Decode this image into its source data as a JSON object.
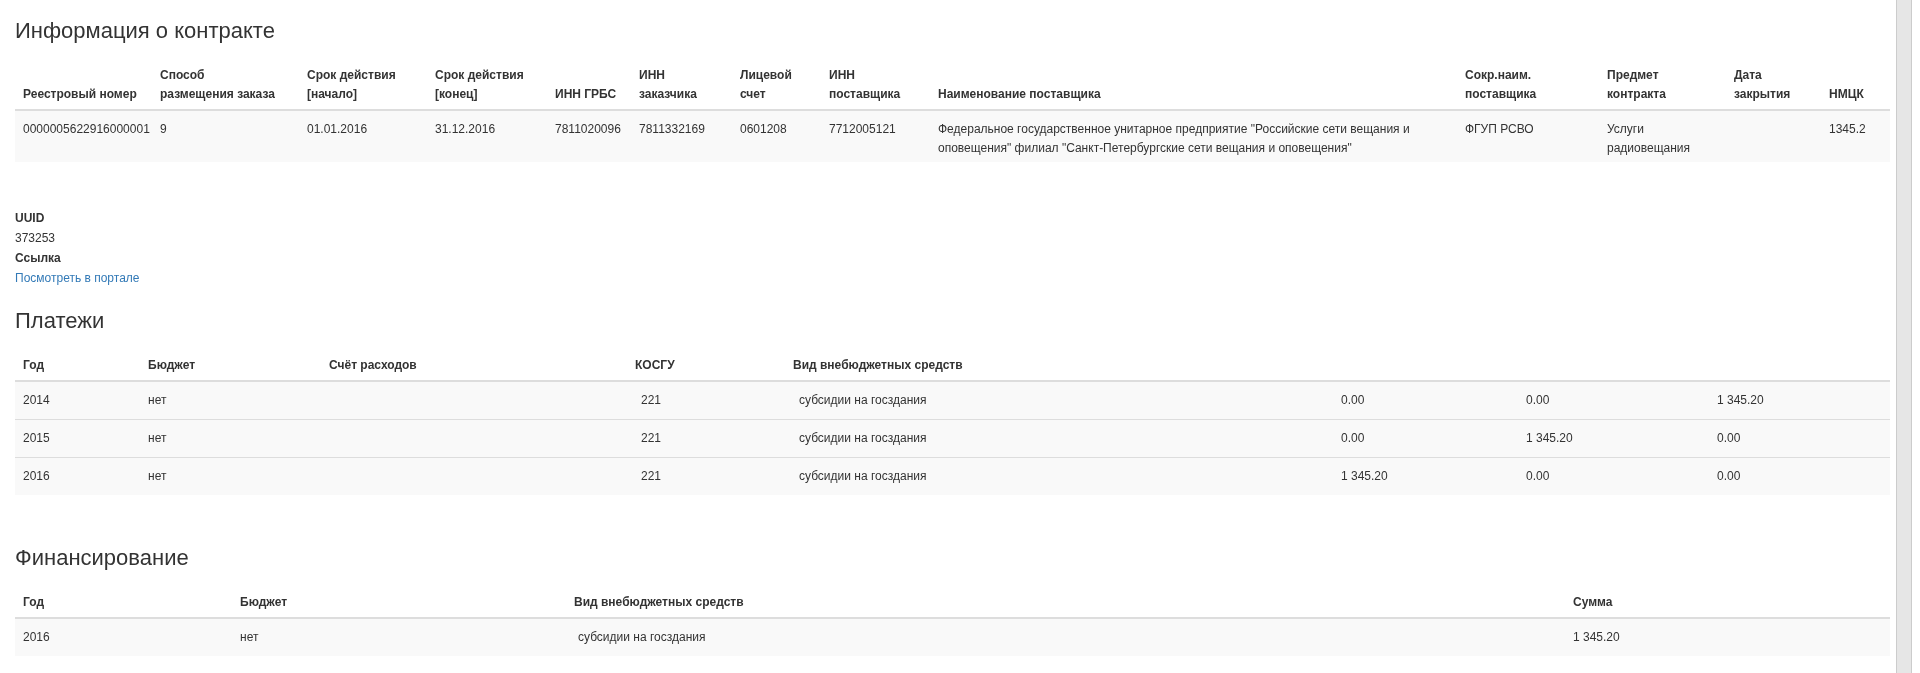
{
  "contract": {
    "title": "Информация о контракте",
    "columns": [
      "Реестровый номер",
      "Способ\nразмещения заказа",
      "Срок действия\n[начало]",
      "Срок действия\n[конец]",
      "ИНН ГРБС",
      "ИНН\nзаказчика",
      "Лицевой\nсчет",
      "ИНН\nпоставщика",
      "Наименование поставщика",
      "Сокр.наим.\nпоставщика",
      "Предмет\nконтракта",
      "Дата\nзакрытия",
      "НМЦК"
    ],
    "rows": [
      {
        "cells": [
          "0000005622916000001",
          "9",
          "01.01.2016",
          "31.12.2016",
          "7811020096",
          "7811332169",
          "0601208",
          "7712005121",
          "Федеральное государственное унитарное предприятие \"Российские сети вещания и оповещения\" филиал \"Санкт-Петербургские сети вещания и оповещения\"",
          "ФГУП РСВО",
          "Услуги радиовещания",
          "",
          "1345.2"
        ]
      }
    ]
  },
  "details": [
    {
      "label": "UUID",
      "value": "373253",
      "kind": "text"
    },
    {
      "label": "Ссылка",
      "value": "Посмотреть в портале",
      "kind": "link"
    }
  ],
  "payments": {
    "title": "Платежи",
    "columns": [
      "Год",
      "Бюджет",
      "Счёт расходов",
      "КОСГУ",
      "Вид внебюджетных средств",
      "",
      "",
      ""
    ],
    "rows": [
      {
        "cells": [
          "2014",
          "нет",
          "",
          "221",
          "субсидии на госздания",
          "0.00",
          "0.00",
          "1 345.20"
        ]
      },
      {
        "cells": [
          "2015",
          "нет",
          "",
          "221",
          "субсидии на госздания",
          "0.00",
          "1 345.20",
          "0.00"
        ]
      },
      {
        "cells": [
          "2016",
          "нет",
          "",
          "221",
          "субсидии на госздания",
          "1 345.20",
          "0.00",
          "0.00"
        ]
      }
    ]
  },
  "financing": {
    "title": "Финансирование",
    "columns": [
      "Год",
      "Бюджет",
      "Вид внебюджетных средств",
      "Сумма"
    ],
    "rows": [
      {
        "cells": [
          "2016",
          "нет",
          "субсидии на госздания",
          "1 345.20"
        ]
      }
    ]
  }
}
